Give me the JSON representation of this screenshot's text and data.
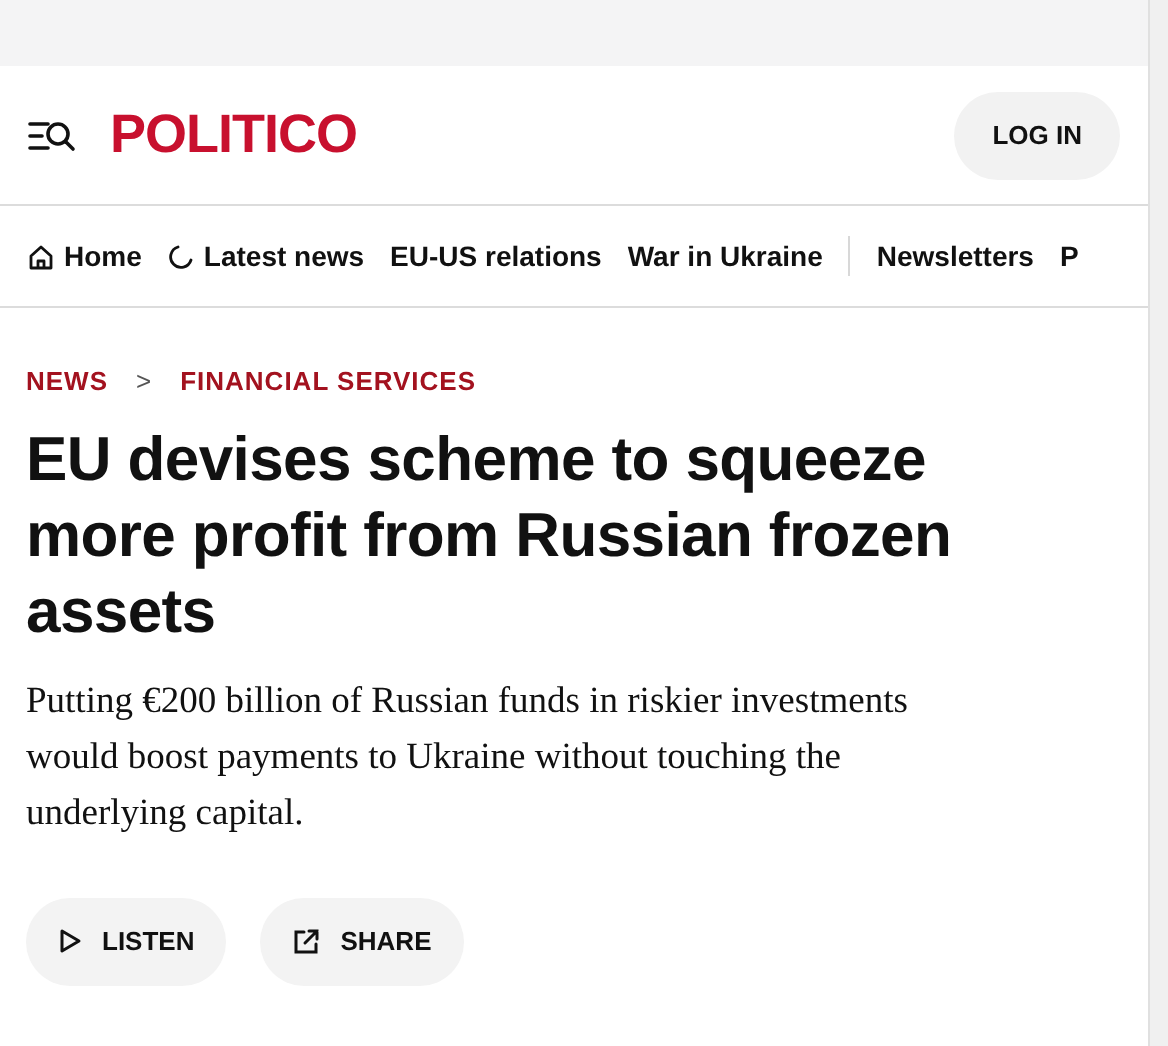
{
  "header": {
    "logo": "POLITICO",
    "login": "LOG IN"
  },
  "nav": {
    "sections": [
      {
        "label": "Home",
        "kind": "home"
      },
      {
        "label": "Latest news",
        "kind": "latest"
      },
      {
        "label": "EU-US relations",
        "kind": "plain"
      },
      {
        "label": "War in Ukraine",
        "kind": "plain"
      }
    ],
    "extras": [
      {
        "label": "Newsletters"
      },
      {
        "label": "P"
      }
    ]
  },
  "breadcrumb": [
    {
      "label": "NEWS"
    },
    {
      "label": "FINANCIAL SERVICES"
    }
  ],
  "breadcrumb_separator": ">",
  "headline": "EU devises scheme to squeeze more profit from Russian frozen assets",
  "dek": "Putting €200 billion of Russian funds in riskier investments would boost payments to Ukraine without touching the underlying capital.",
  "actions": [
    {
      "label": "LISTEN",
      "kind": "listen"
    },
    {
      "label": "SHARE",
      "kind": "share"
    }
  ]
}
